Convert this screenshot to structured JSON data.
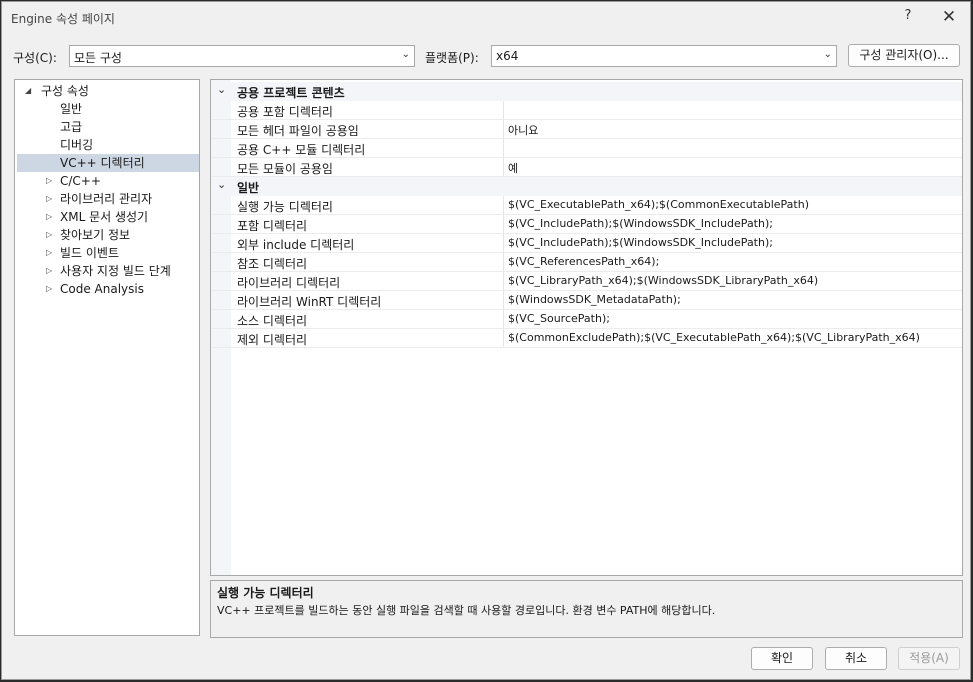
{
  "window": {
    "title": "Engine 속성 페이지",
    "help": "?",
    "close": "✕"
  },
  "config": {
    "label": "구성(C):",
    "value": "모든 구성"
  },
  "platform": {
    "label": "플랫폼(P):",
    "value": "x64"
  },
  "config_manager": "구성 관리자(O)...",
  "tree": {
    "root": "구성 속성",
    "items": [
      {
        "label": "일반",
        "expandable": false
      },
      {
        "label": "고급",
        "expandable": false
      },
      {
        "label": "디버깅",
        "expandable": false
      },
      {
        "label": "VC++ 디렉터리",
        "expandable": false,
        "selected": true
      },
      {
        "label": "C/C++",
        "expandable": true
      },
      {
        "label": "라이브러리 관리자",
        "expandable": true
      },
      {
        "label": "XML 문서 생성기",
        "expandable": true
      },
      {
        "label": "찾아보기 정보",
        "expandable": true
      },
      {
        "label": "빌드 이벤트",
        "expandable": true
      },
      {
        "label": "사용자 지정 빌드 단계",
        "expandable": true
      },
      {
        "label": "Code Analysis",
        "expandable": true
      }
    ]
  },
  "grid": {
    "categories": [
      {
        "name": "공용 프로젝트 콘텐츠",
        "rows": [
          {
            "name": "공용 포함 디렉터리",
            "value": ""
          },
          {
            "name": "모든 헤더 파일이 공용임",
            "value": "아니요"
          },
          {
            "name": "공용 C++ 모듈 디렉터리",
            "value": ""
          },
          {
            "name": "모든 모듈이 공용임",
            "value": "예"
          }
        ]
      },
      {
        "name": "일반",
        "rows": [
          {
            "name": "실행 가능 디렉터리",
            "value": "$(VC_ExecutablePath_x64);$(CommonExecutablePath)"
          },
          {
            "name": "포함 디렉터리",
            "value": "$(VC_IncludePath);$(WindowsSDK_IncludePath);"
          },
          {
            "name": "외부 include 디렉터리",
            "value": "$(VC_IncludePath);$(WindowsSDK_IncludePath);"
          },
          {
            "name": "참조 디렉터리",
            "value": "$(VC_ReferencesPath_x64);"
          },
          {
            "name": "라이브러리 디렉터리",
            "value": "$(VC_LibraryPath_x64);$(WindowsSDK_LibraryPath_x64)"
          },
          {
            "name": "라이브러리 WinRT 디렉터리",
            "value": "$(WindowsSDK_MetadataPath);"
          },
          {
            "name": "소스 디렉터리",
            "value": "$(VC_SourcePath);"
          },
          {
            "name": "제외 디렉터리",
            "value": "$(CommonExcludePath);$(VC_ExecutablePath_x64);$(VC_LibraryPath_x64)"
          }
        ]
      }
    ]
  },
  "description": {
    "title": "실행 가능 디렉터리",
    "text": "VC++ 프로젝트를 빌드하는 동안 실행 파일을 검색할 때 사용할 경로입니다.  환경 변수 PATH에 해당합니다."
  },
  "buttons": {
    "ok": "확인",
    "cancel": "취소",
    "apply": "적용(A)"
  }
}
